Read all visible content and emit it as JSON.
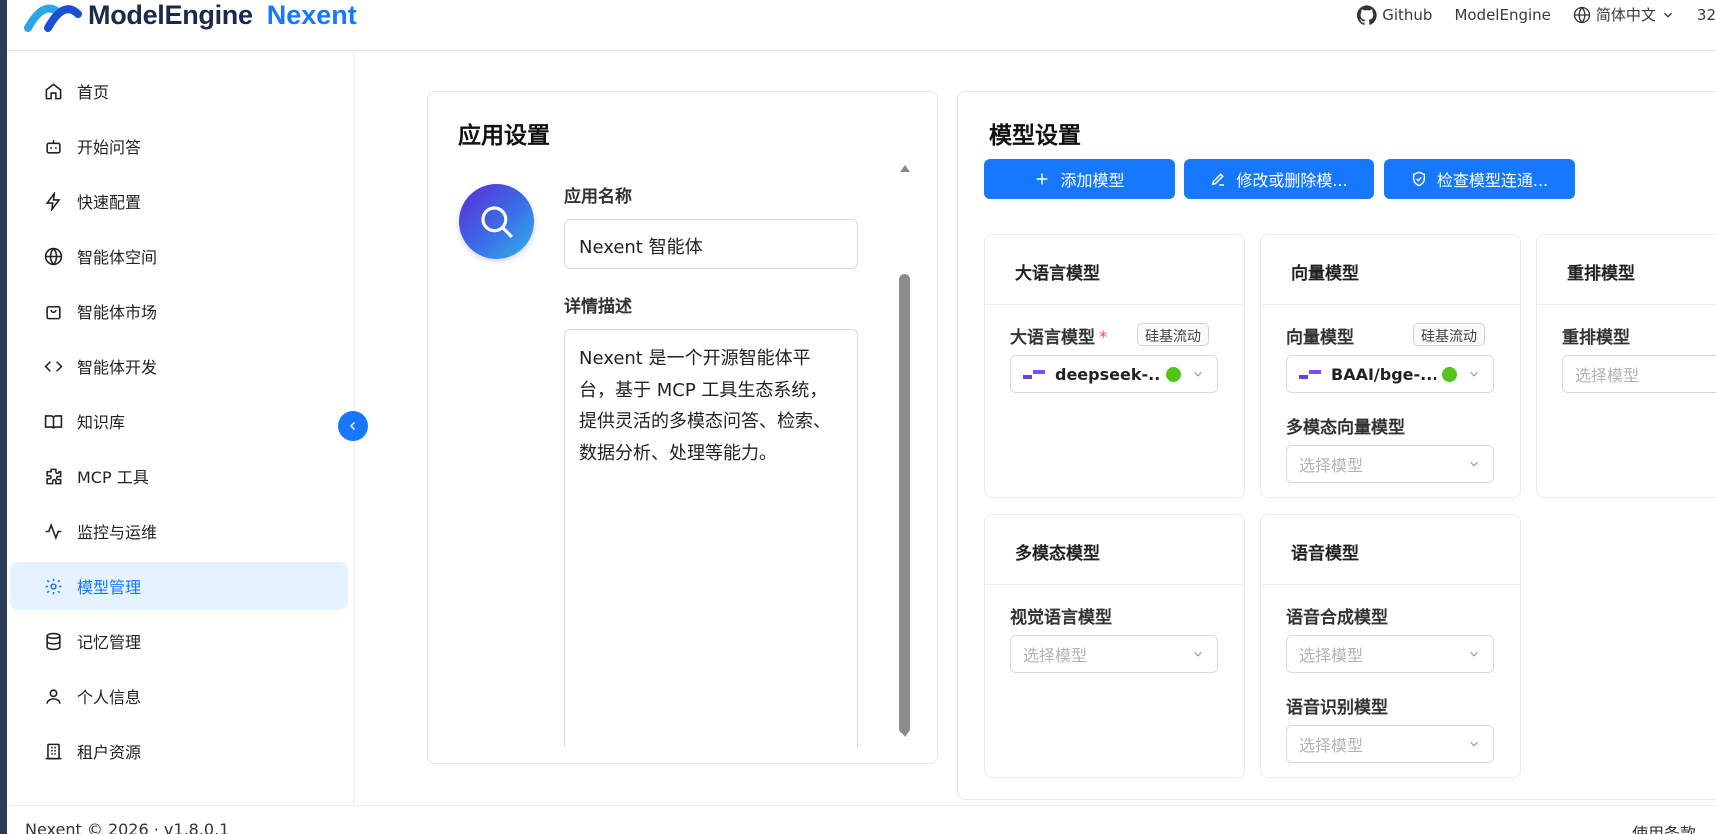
{
  "header": {
    "brand": "ModelEngine",
    "product": "Nexent",
    "links": {
      "github": "Github",
      "modelengine": "ModelEngine",
      "language": "简体中文",
      "user_partial": "32"
    }
  },
  "sidebar": {
    "items": [
      {
        "label": "首页",
        "icon": "home-icon"
      },
      {
        "label": "开始问答",
        "icon": "bot-icon"
      },
      {
        "label": "快速配置",
        "icon": "zap-icon"
      },
      {
        "label": "智能体空间",
        "icon": "globe-icon"
      },
      {
        "label": "智能体市场",
        "icon": "shopping-bag-icon"
      },
      {
        "label": "智能体开发",
        "icon": "code-icon"
      },
      {
        "label": "知识库",
        "icon": "book-icon"
      },
      {
        "label": "MCP 工具",
        "icon": "puzzle-icon"
      },
      {
        "label": "监控与运维",
        "icon": "activity-icon"
      },
      {
        "label": "模型管理",
        "icon": "gear-icon",
        "active": true
      },
      {
        "label": "记忆管理",
        "icon": "database-icon"
      },
      {
        "label": "个人信息",
        "icon": "user-icon"
      },
      {
        "label": "租户资源",
        "icon": "building-icon"
      }
    ]
  },
  "app_settings": {
    "title": "应用设置",
    "name_label": "应用名称",
    "name_value": "Nexent 智能体",
    "desc_label": "详情描述",
    "desc_value": "Nexent 是一个开源智能体平台，基于 MCP 工具生态系统，提供灵活的多模态问答、检索、数据分析、处理等能力。"
  },
  "model_settings": {
    "title": "模型设置",
    "buttons": {
      "add": "添加模型",
      "edit": "修改或删除模...",
      "check": "检查模型连通..."
    },
    "cards": {
      "llm": {
        "title": "大语言模型",
        "field_label": "大语言模型",
        "required_mark": "*",
        "provider_tag": "硅基流动",
        "selected": "deepseek-..."
      },
      "embedding": {
        "title": "向量模型",
        "field_label": "向量模型",
        "provider_tag": "硅基流动",
        "selected": "BAAI/bge-...",
        "multi_label": "多模态向量模型",
        "multi_placeholder": "选择模型"
      },
      "rerank": {
        "title": "重排模型",
        "field_label": "重排模型",
        "placeholder": "选择模型"
      },
      "multimodal": {
        "title": "多模态模型",
        "field_label": "视觉语言模型",
        "placeholder": "选择模型"
      },
      "voice": {
        "title": "语音模型",
        "tts_label": "语音合成模型",
        "tts_placeholder": "选择模型",
        "asr_label": "语音识别模型",
        "asr_placeholder": "选择模型"
      }
    },
    "status_color": "#52c41a",
    "accent": "#1677ff"
  },
  "footer": {
    "copyright": "Nexent © 2026 · v1.8.0.1",
    "terms": "使用条款"
  }
}
